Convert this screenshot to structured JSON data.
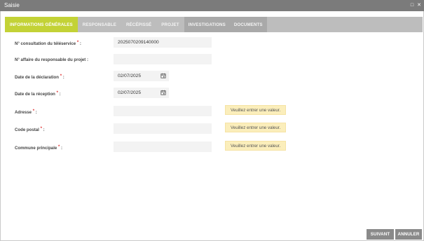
{
  "window": {
    "title": "Saisie",
    "controls": {
      "maximize": "□",
      "close": "✕"
    }
  },
  "tabs": [
    {
      "label": "INFORMATIONS GÉNÉRALES",
      "active": true
    },
    {
      "label": "RESPONSABLE"
    },
    {
      "label": "RÉCÉPISSÉ"
    },
    {
      "label": "PROJET"
    },
    {
      "label": "INVESTIGATIONS"
    },
    {
      "label": "DOCUMENTS"
    }
  ],
  "form": {
    "consultation": {
      "label": "N° consultation du téléservice",
      "required": "*",
      "suffix": " :",
      "value": "2025070209140000"
    },
    "affaire": {
      "label": "N° affaire du responsable du projet :",
      "value": ""
    },
    "declaration": {
      "label": "Date de la déclaration",
      "required": "*",
      "suffix": " :",
      "value": "02/07/2025"
    },
    "reception": {
      "label": "Date de la réception",
      "required": "*",
      "suffix": " :",
      "value": "02/07/2025"
    },
    "adresse": {
      "label": "Adresse",
      "required": "*",
      "suffix": " :",
      "value": "",
      "tooltip": "Veuillez entrer une valeur."
    },
    "code_postal": {
      "label": "Code postal",
      "required": "*",
      "suffix": " :",
      "value": "",
      "tooltip": "Veuillez entrer une valeur."
    },
    "commune": {
      "label": "Commune principale",
      "required": "*",
      "suffix": " :",
      "value": "",
      "tooltip": "Veuillez entrer une valeur."
    }
  },
  "buttons": {
    "next": "SUIVANT",
    "cancel": "ANNULER"
  },
  "colors": {
    "accent": "#c3d236",
    "tooltip_bg": "#fbeebb",
    "required": "#e03030"
  }
}
